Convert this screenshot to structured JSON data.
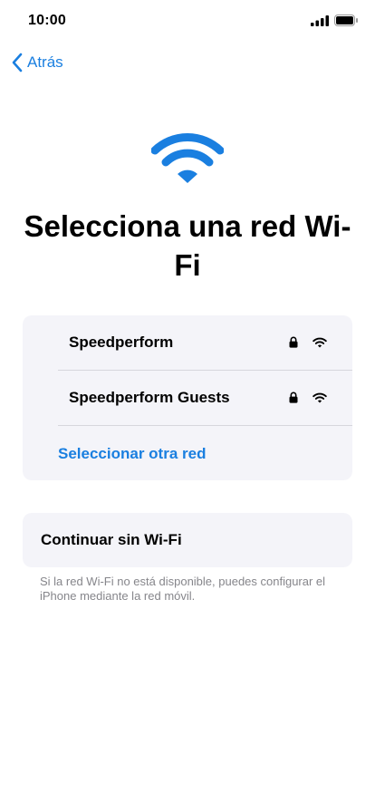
{
  "status_bar": {
    "time": "10:00",
    "icons": [
      "cellular-signal-icon",
      "battery-icon"
    ]
  },
  "nav": {
    "back_label": "Atrás",
    "back_icon": "chevron-left-icon"
  },
  "hero": {
    "icon": "wifi-icon",
    "title": "Selecciona una red Wi-Fi"
  },
  "networks": [
    {
      "name": "Speedperform",
      "secured": true,
      "lock_icon": "lock-icon",
      "signal_icon": "wifi-signal-icon"
    },
    {
      "name": "Speedperform Guests",
      "secured": true,
      "lock_icon": "lock-icon",
      "signal_icon": "wifi-signal-icon"
    }
  ],
  "other_network_label": "Seleccionar otra red",
  "continue_without_wifi_label": "Continuar sin Wi-Fi",
  "footnote": "Si la red Wi-Fi no está disponible, puedes configurar el iPhone mediante la red móvil.",
  "colors": {
    "accent": "#1a7fe0",
    "card_background": "#f4f4f9",
    "secondary_text": "#86868b"
  }
}
